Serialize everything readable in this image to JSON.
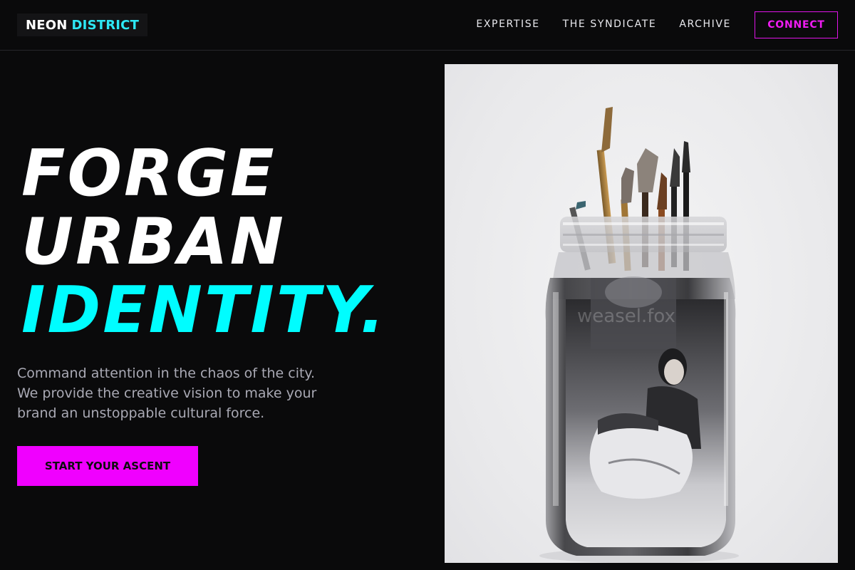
{
  "nav": {
    "logo_word1": "NEON",
    "logo_word2": "DISTRICT",
    "links": [
      "EXPERTISE",
      "THE SYNDICATE",
      "ARCHIVE"
    ],
    "connect_label": "CONNECT"
  },
  "hero": {
    "title_line1": "FORGE",
    "title_line2": "URBAN",
    "title_line3": "IDENTITY.",
    "description_line1": "Command attention in the chaos of the city.",
    "description_line2": "We provide the creative vision to make your",
    "description_line3": "brand an unstoppable cultural force.",
    "cta_label": "START YOUR ASCENT"
  },
  "image": {
    "watermark": "weasel.fox"
  },
  "colors": {
    "accent_cyan": "#00fdff",
    "accent_magenta": "#f000ff",
    "background": "#0a0a0b"
  }
}
